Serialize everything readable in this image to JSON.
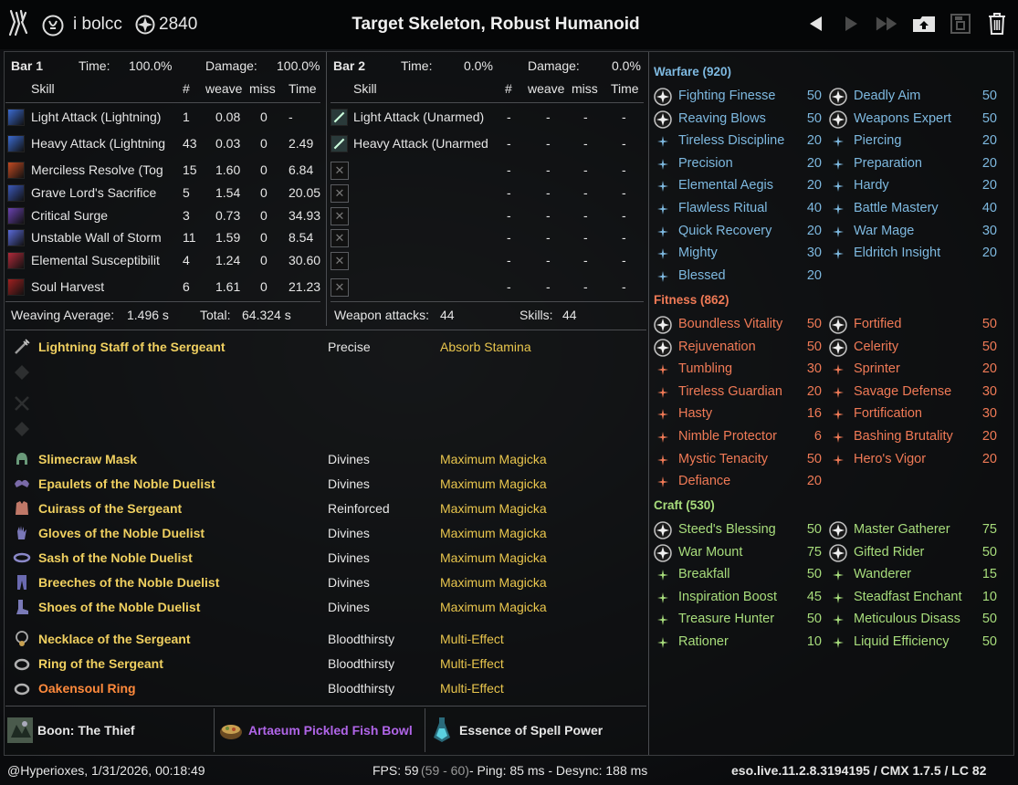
{
  "header": {
    "username": "i bolcc",
    "champion_points": "2840",
    "title": "Target Skeleton, Robust Humanoid",
    "icons": [
      "guild-emblem-icon",
      "profile-icon",
      "champion-icon",
      "prev-arrow-icon",
      "next-arrow-icon",
      "last-arrow-icon",
      "upload-icon",
      "save-icon",
      "trash-icon"
    ]
  },
  "bar1": {
    "label": "Bar 1",
    "time_label": "Time:",
    "time_value": "100.0%",
    "damage_label": "Damage:",
    "damage_value": "100.0%",
    "cols": {
      "skill": "Skill",
      "count": "#",
      "weave": "weave",
      "miss": "miss",
      "time": "Time"
    },
    "rows": [
      {
        "name": "Light Attack (Lightning)",
        "count": "1",
        "weave": "0.08",
        "miss": "0",
        "time": "-",
        "color": "#3b6bd0"
      },
      {
        "name": "Heavy Attack (Lightning",
        "count": "43",
        "weave": "0.03",
        "miss": "0",
        "time": "2.49",
        "color": "#3b6bd0"
      },
      {
        "name": "Merciless Resolve (Tog",
        "count": "15",
        "weave": "1.60",
        "miss": "0",
        "time": "6.84",
        "color": "#c24a22"
      },
      {
        "name": "Grave Lord's Sacrifice",
        "count": "5",
        "weave": "1.54",
        "miss": "0",
        "time": "20.05",
        "color": "#3b58b8"
      },
      {
        "name": "Critical Surge",
        "count": "3",
        "weave": "0.73",
        "miss": "0",
        "time": "34.93",
        "color": "#6a42b0"
      },
      {
        "name": "Unstable Wall of Storm",
        "count": "11",
        "weave": "1.59",
        "miss": "0",
        "time": "8.54",
        "color": "#5a6ad8"
      },
      {
        "name": "Elemental Susceptibilit",
        "count": "4",
        "weave": "1.24",
        "miss": "0",
        "time": "30.60",
        "color": "#b02a3a"
      },
      {
        "name": "Soul Harvest",
        "count": "6",
        "weave": "1.61",
        "miss": "0",
        "time": "21.23",
        "color": "#a02020"
      }
    ],
    "weaving_label": "Weaving Average:",
    "weaving_value": "1.496 s",
    "total_label": "Total:",
    "total_value": "64.324 s"
  },
  "bar2": {
    "label": "Bar 2",
    "time_label": "Time:",
    "time_value": "0.0%",
    "damage_label": "Damage:",
    "damage_value": "0.0%",
    "cols": {
      "skill": "Skill",
      "count": "#",
      "weave": "weave",
      "miss": "miss",
      "time": "Time"
    },
    "rows": [
      {
        "name": "Light Attack (Unarmed)",
        "count": "-",
        "weave": "-",
        "miss": "-",
        "time": "-"
      },
      {
        "name": "Heavy Attack (Unarmed",
        "count": "-",
        "weave": "-",
        "miss": "-",
        "time": "-"
      },
      {
        "name": "",
        "count": "-",
        "weave": "-",
        "miss": "-",
        "time": "-"
      },
      {
        "name": "",
        "count": "-",
        "weave": "-",
        "miss": "-",
        "time": "-"
      },
      {
        "name": "",
        "count": "-",
        "weave": "-",
        "miss": "-",
        "time": "-"
      },
      {
        "name": "",
        "count": "-",
        "weave": "-",
        "miss": "-",
        "time": "-"
      },
      {
        "name": "",
        "count": "-",
        "weave": "-",
        "miss": "-",
        "time": "-"
      },
      {
        "name": "",
        "count": "-",
        "weave": "-",
        "miss": "-",
        "time": "-"
      }
    ],
    "weapon_label": "Weapon attacks:",
    "weapon_value": "44",
    "skills_label": "Skills:",
    "skills_value": "44"
  },
  "gear": {
    "weapon": {
      "name": "Lightning Staff of the Sergeant",
      "trait": "Precise",
      "enchant": "Absorb Stamina"
    },
    "armor": [
      {
        "name": "Slimecraw Mask",
        "trait": "Divines",
        "enchant": "Maximum Magicka",
        "icon": "helmet-icon"
      },
      {
        "name": "Epaulets of the Noble Duelist",
        "trait": "Divines",
        "enchant": "Maximum Magicka",
        "icon": "shoulders-icon"
      },
      {
        "name": "Cuirass of the Sergeant",
        "trait": "Reinforced",
        "enchant": "Maximum Magicka",
        "icon": "chest-icon"
      },
      {
        "name": "Gloves of the Noble Duelist",
        "trait": "Divines",
        "enchant": "Maximum Magicka",
        "icon": "gloves-icon"
      },
      {
        "name": "Sash of the Noble Duelist",
        "trait": "Divines",
        "enchant": "Maximum Magicka",
        "icon": "belt-icon"
      },
      {
        "name": "Breeches of the Noble Duelist",
        "trait": "Divines",
        "enchant": "Maximum Magicka",
        "icon": "legs-icon"
      },
      {
        "name": "Shoes of the Noble Duelist",
        "trait": "Divines",
        "enchant": "Maximum Magicka",
        "icon": "boots-icon"
      }
    ],
    "jewelry": [
      {
        "name": "Necklace of the Sergeant",
        "trait": "Bloodthirsty",
        "enchant": "Multi-Effect",
        "orange": false,
        "icon": "necklace-icon"
      },
      {
        "name": "Ring of the Sergeant",
        "trait": "Bloodthirsty",
        "enchant": "Multi-Effect",
        "orange": false,
        "icon": "ring-icon"
      },
      {
        "name": "Oakensoul Ring",
        "trait": "Bloodthirsty",
        "enchant": "Multi-Effect",
        "orange": true,
        "icon": "ring-icon"
      }
    ]
  },
  "buffs": {
    "boon": "Boon: The Thief",
    "food": "Artaeum Pickled Fish Bowl",
    "drink": "Essence of Spell Power",
    "food_color": "#b065e8"
  },
  "champion": {
    "warfare": {
      "title": "Warfare (920)",
      "left": [
        {
          "name": "Fighting Finesse",
          "value": "50",
          "slotted": true
        },
        {
          "name": "Reaving Blows",
          "value": "50",
          "slotted": true
        },
        {
          "name": "Tireless Discipline",
          "value": "20",
          "slotted": false
        },
        {
          "name": "Precision",
          "value": "20",
          "slotted": false
        },
        {
          "name": "Elemental Aegis",
          "value": "20",
          "slotted": false
        },
        {
          "name": "Flawless Ritual",
          "value": "40",
          "slotted": false
        },
        {
          "name": "Quick Recovery",
          "value": "20",
          "slotted": false
        },
        {
          "name": "Mighty",
          "value": "30",
          "slotted": false
        },
        {
          "name": "Blessed",
          "value": "20",
          "slotted": false
        }
      ],
      "right": [
        {
          "name": "Deadly Aim",
          "value": "50",
          "slotted": true
        },
        {
          "name": "Weapons Expert",
          "value": "50",
          "slotted": true
        },
        {
          "name": "Piercing",
          "value": "20",
          "slotted": false
        },
        {
          "name": "Preparation",
          "value": "20",
          "slotted": false
        },
        {
          "name": "Hardy",
          "value": "20",
          "slotted": false
        },
        {
          "name": "Battle Mastery",
          "value": "40",
          "slotted": false
        },
        {
          "name": "War Mage",
          "value": "30",
          "slotted": false
        },
        {
          "name": "Eldritch Insight",
          "value": "20",
          "slotted": false
        }
      ]
    },
    "fitness": {
      "title": "Fitness (862)",
      "left": [
        {
          "name": "Boundless Vitality",
          "value": "50",
          "slotted": true
        },
        {
          "name": "Rejuvenation",
          "value": "50",
          "slotted": true
        },
        {
          "name": "Tumbling",
          "value": "30",
          "slotted": false
        },
        {
          "name": "Tireless Guardian",
          "value": "20",
          "slotted": false
        },
        {
          "name": "Hasty",
          "value": "16",
          "slotted": false
        },
        {
          "name": "Nimble Protector",
          "value": "6",
          "slotted": false
        },
        {
          "name": "Mystic Tenacity",
          "value": "50",
          "slotted": false
        },
        {
          "name": "Defiance",
          "value": "20",
          "slotted": false
        }
      ],
      "right": [
        {
          "name": "Fortified",
          "value": "50",
          "slotted": true
        },
        {
          "name": "Celerity",
          "value": "50",
          "slotted": true
        },
        {
          "name": "Sprinter",
          "value": "20",
          "slotted": false
        },
        {
          "name": "Savage Defense",
          "value": "30",
          "slotted": false
        },
        {
          "name": "Fortification",
          "value": "30",
          "slotted": false
        },
        {
          "name": "Bashing Brutality",
          "value": "20",
          "slotted": false
        },
        {
          "name": "Hero's Vigor",
          "value": "20",
          "slotted": false
        }
      ]
    },
    "craft": {
      "title": "Craft (530)",
      "left": [
        {
          "name": "Steed's Blessing",
          "value": "50",
          "slotted": true
        },
        {
          "name": "War Mount",
          "value": "75",
          "slotted": true
        },
        {
          "name": "Breakfall",
          "value": "50",
          "slotted": false
        },
        {
          "name": "Inspiration Boost",
          "value": "45",
          "slotted": false
        },
        {
          "name": "Treasure Hunter",
          "value": "50",
          "slotted": false
        },
        {
          "name": "Rationer",
          "value": "10",
          "slotted": false
        }
      ],
      "right": [
        {
          "name": "Master Gatherer",
          "value": "75",
          "slotted": true
        },
        {
          "name": "Gifted Rider",
          "value": "50",
          "slotted": true
        },
        {
          "name": "Wanderer",
          "value": "15",
          "slotted": false
        },
        {
          "name": "Steadfast Enchant",
          "value": "10",
          "slotted": false
        },
        {
          "name": "Meticulous Disass",
          "value": "50",
          "slotted": false
        },
        {
          "name": "Liquid Efficiency",
          "value": "50",
          "slotted": false
        }
      ]
    },
    "colors": {
      "warfare": "#7eb9e0",
      "fitness": "#f07a56",
      "craft": "#a8dd7c"
    }
  },
  "footer": {
    "author": "@Hyperioxes, 1/31/2026, 00:18:49",
    "fps_label": "FPS: 59",
    "fps_range": "(59 - 60)",
    "ping": "- Ping: 85 ms - Desync: 188 ms",
    "version": "eso.live.11.2.8.3194195 / CMX 1.7.5 / LC 82"
  }
}
